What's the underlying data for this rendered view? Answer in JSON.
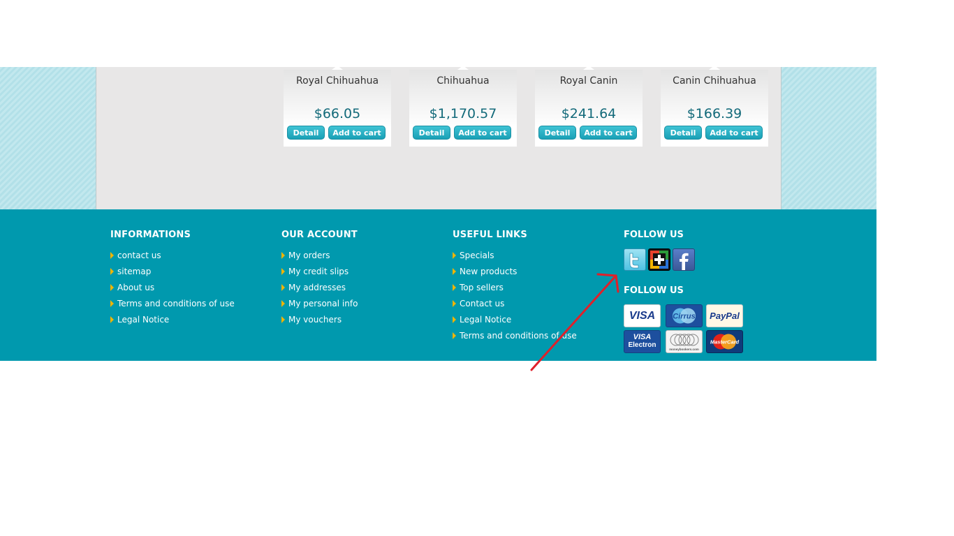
{
  "products": [
    {
      "name": "Royal Chihuahua",
      "price": "$66.05",
      "detail_label": "Detail",
      "cart_label": "Add to cart"
    },
    {
      "name": "Chihuahua",
      "price": "$1,170.57",
      "detail_label": "Detail",
      "cart_label": "Add to cart"
    },
    {
      "name": "Royal Canin",
      "price": "$241.64",
      "detail_label": "Detail",
      "cart_label": "Add to cart"
    },
    {
      "name": "Canin Chihuahua",
      "price": "$166.39",
      "detail_label": "Detail",
      "cart_label": "Add to cart"
    }
  ],
  "footer": {
    "informations": {
      "title": "INFORMATIONS",
      "links": [
        "contact us",
        "sitemap",
        "About us",
        "Terms and conditions of use",
        "Legal Notice"
      ]
    },
    "account": {
      "title": "OUR ACCOUNT",
      "links": [
        "My orders",
        "My credit slips",
        "My addresses",
        "My personal info",
        "My vouchers"
      ]
    },
    "useful": {
      "title": "USEFUL LINKS",
      "links": [
        "Specials",
        "New products",
        "Top sellers",
        "Contact us",
        "Legal Notice",
        "Terms and conditions of use"
      ]
    },
    "follow": {
      "title": "FOLLOW US",
      "title2": "FOLLOW US",
      "social": [
        "twitter-icon",
        "google-plus-icon",
        "facebook-icon"
      ],
      "cards": {
        "visa": "VISA",
        "cirrus": "Cirrus",
        "paypal": "PayPal",
        "electron_line1": "VISA",
        "electron_line2": "Electron",
        "moneybookers": "moneybookers.com",
        "mastercard": "MasterCard"
      }
    }
  },
  "colors": {
    "footer_bg": "#0099ae",
    "button": "#1aa0b6",
    "price": "#136a7a",
    "bullet": "#f0b400",
    "annotation_arrow": "#e0202a"
  }
}
